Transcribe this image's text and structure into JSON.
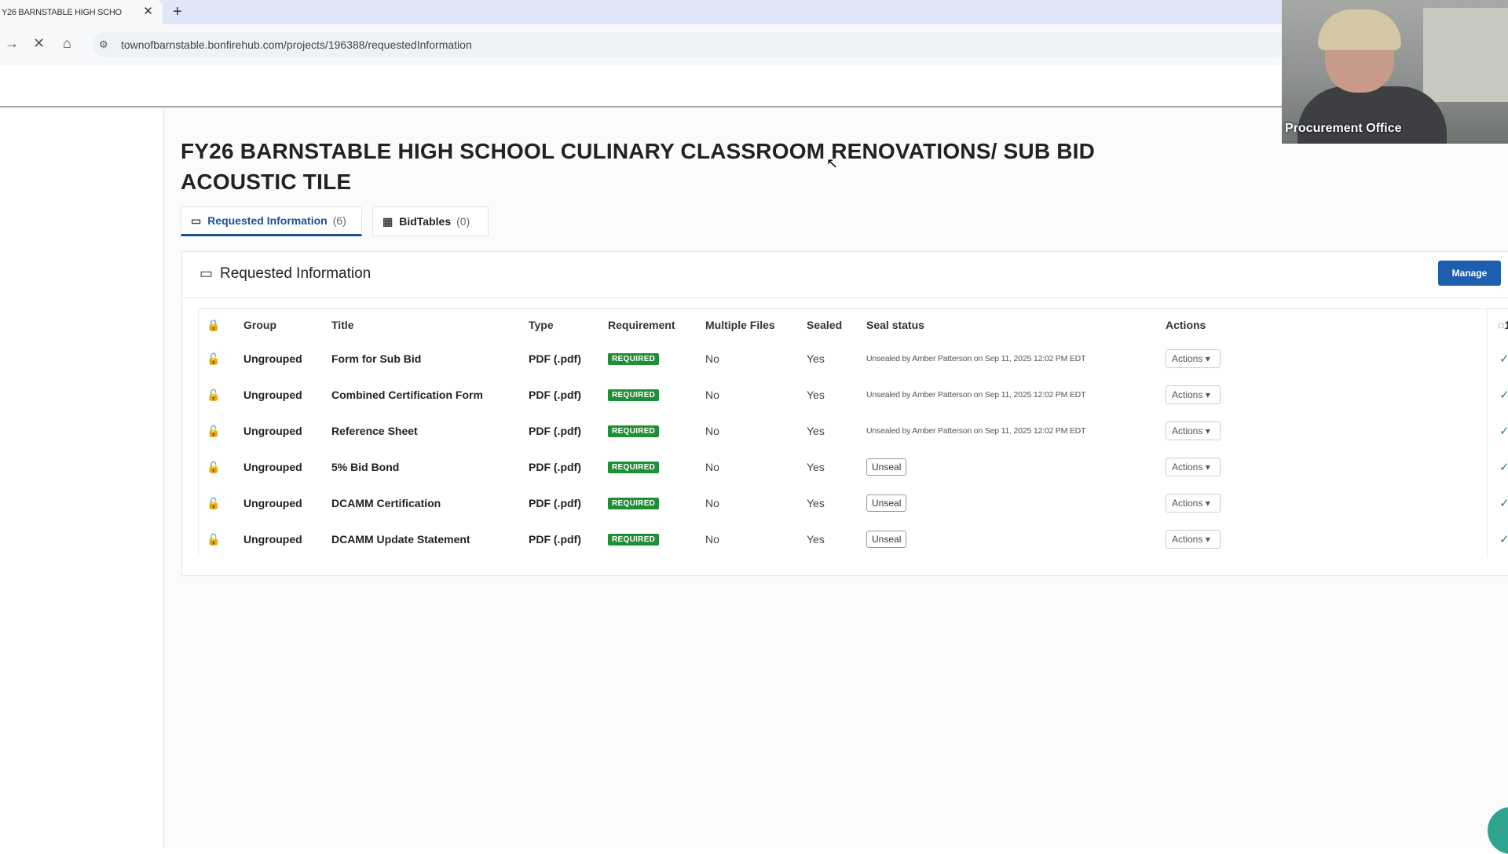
{
  "browser": {
    "tab_title": "Y26 BARNSTABLE HIGH SCHO",
    "tab_close": "✕",
    "new_tab": "+",
    "url": "townofbarnstable.bonfirehub.com/projects/196388/requestedInformation",
    "icons": [
      "arrow-right-icon",
      "stop-icon",
      "home-icon",
      "site-settings-icon"
    ]
  },
  "page": {
    "title": "FY26 BARNSTABLE HIGH SCHOOL CULINARY CLASSROOM RENOVATIONS/ SUB BID ACOUSTIC TILE",
    "tabs": [
      {
        "label": "Requested Information",
        "count": "(6)",
        "active": true
      },
      {
        "label": "BidTables",
        "count": "(0)",
        "active": false
      }
    ]
  },
  "panel": {
    "title": "Requested Information",
    "manage_label": "Manage",
    "columns": [
      "Group",
      "Title",
      "Type",
      "Requirement",
      "Multiple Files",
      "Sealed",
      "Seal status",
      "Actions",
      "1"
    ],
    "rows": [
      {
        "group": "Ungrouped",
        "title": "Form for Sub Bid",
        "type": "PDF (.pdf)",
        "requirement": "REQUIRED",
        "multiple_files": "No",
        "sealed": "Yes",
        "seal_status": "Unsealed by Amber Patterson on Sep 11, 2025 12:02 PM EDT",
        "action": "Actions"
      },
      {
        "group": "Ungrouped",
        "title": "Combined Certification Form",
        "type": "PDF (.pdf)",
        "requirement": "REQUIRED",
        "multiple_files": "No",
        "sealed": "Yes",
        "seal_status": "Unsealed by Amber Patterson on Sep 11, 2025 12:02 PM EDT",
        "action": "Actions"
      },
      {
        "group": "Ungrouped",
        "title": "Reference Sheet",
        "type": "PDF (.pdf)",
        "requirement": "REQUIRED",
        "multiple_files": "No",
        "sealed": "Yes",
        "seal_status": "Unsealed by Amber Patterson on Sep 11, 2025 12:02 PM EDT",
        "action": "Actions"
      },
      {
        "group": "Ungrouped",
        "title": "5% Bid Bond",
        "type": "PDF (.pdf)",
        "requirement": "REQUIRED",
        "multiple_files": "No",
        "sealed": "Yes",
        "seal_button": "Unseal",
        "action": "Actions"
      },
      {
        "group": "Ungrouped",
        "title": "DCAMM Certification",
        "type": "PDF (.pdf)",
        "requirement": "REQUIRED",
        "multiple_files": "No",
        "sealed": "Yes",
        "seal_button": "Unseal",
        "action": "Actions"
      },
      {
        "group": "Ungrouped",
        "title": "DCAMM Update Statement",
        "type": "PDF (.pdf)",
        "requirement": "REQUIRED",
        "multiple_files": "No",
        "sealed": "Yes",
        "seal_button": "Unseal",
        "action": "Actions"
      }
    ]
  },
  "video": {
    "participant_name": "Procurement Office"
  },
  "colors": {
    "accent": "#1d4f91",
    "manage_button": "#1d5fae",
    "required_badge": "#1f8f36",
    "unlock_icon": "#e8932a",
    "check": "#1f8f36"
  }
}
